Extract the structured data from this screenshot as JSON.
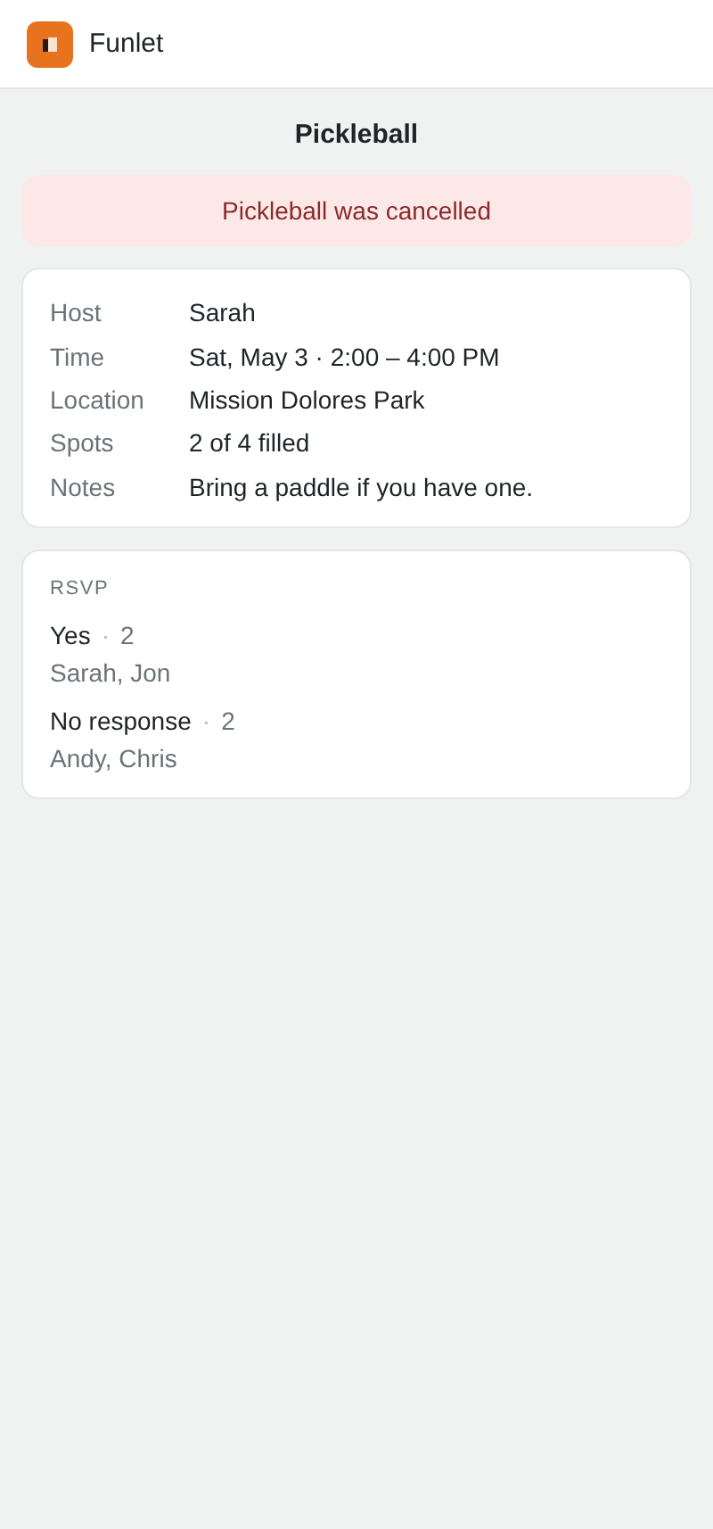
{
  "app": {
    "name": "Funlet"
  },
  "title": "Pickleball",
  "banner": {
    "text": "Pickleball was cancelled"
  },
  "details": [
    {
      "label": "Host",
      "value": "Sarah"
    },
    {
      "label": "Time",
      "value": "Sat, May 3 · 2:00 – 4:00 PM"
    },
    {
      "label": "Location",
      "value": "Mission Dolores Park"
    },
    {
      "label": "Spots",
      "value": "2 of 4 filled"
    },
    {
      "label": "Notes",
      "value": "Bring a paddle if you have one."
    }
  ],
  "rsvp": {
    "heading": "RSVP",
    "groups": [
      {
        "label": "Yes",
        "separator": "·",
        "count": "2",
        "names": "Sarah, Jon"
      },
      {
        "label": "No response",
        "separator": "·",
        "count": "2",
        "names": "Andy, Chris"
      }
    ]
  }
}
